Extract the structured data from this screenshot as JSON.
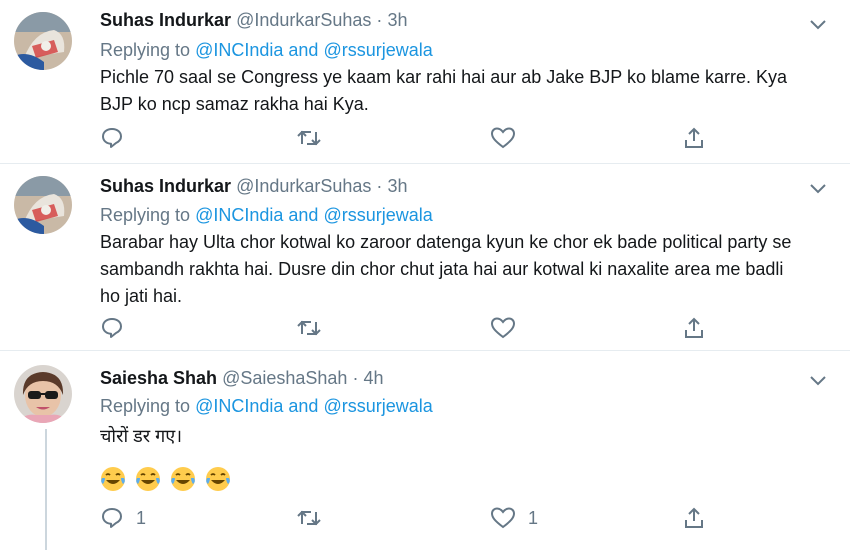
{
  "tweets": [
    {
      "name": "Suhas Indurkar",
      "handle": "@IndurkarSuhas",
      "separator": "·",
      "time": "3h",
      "replying_prefix": "Replying to",
      "mention1": "@INCIndia",
      "conj": "and",
      "mention2": "@rssurjewala",
      "text": "Pichle 70 saal se Congress ye kaam kar rahi hai aur ab Jake BJP ko blame karre. Kya BJP ko ncp samaz rakha hai Kya.",
      "reply_count": "",
      "like_count": ""
    },
    {
      "name": "Suhas Indurkar",
      "handle": "@IndurkarSuhas",
      "separator": "·",
      "time": "3h",
      "replying_prefix": "Replying to",
      "mention1": "@INCIndia",
      "conj": "and",
      "mention2": "@rssurjewala",
      "text": "Barabar hay Ulta chor kotwal ko zaroor datenga kyun ke chor ek bade political party se sambandh rakhta hai. Dusre din chor chut jata hai aur kotwal ki naxalite area me badli ho jati hai.",
      "reply_count": "",
      "like_count": ""
    },
    {
      "name": "Saiesha Shah",
      "handle": "@SaieshaShah",
      "separator": "·",
      "time": "4h",
      "replying_prefix": "Replying to",
      "mention1": "@INCIndia",
      "conj": "and",
      "mention2": "@rssurjewala",
      "text": "चोरों डर गए।",
      "emoji_count": 4,
      "reply_count": "1",
      "like_count": "1"
    }
  ],
  "icons": {
    "reply": "reply-icon",
    "retweet": "retweet-icon",
    "like": "like-icon",
    "share": "share-icon",
    "more": "chevron-down-icon",
    "emoji": "tears-of-joy-emoji"
  },
  "colors": {
    "link": "#1b95e0",
    "muted": "#657786",
    "separator": "#e6ecf0",
    "thread_line": "#ccd6dd"
  }
}
